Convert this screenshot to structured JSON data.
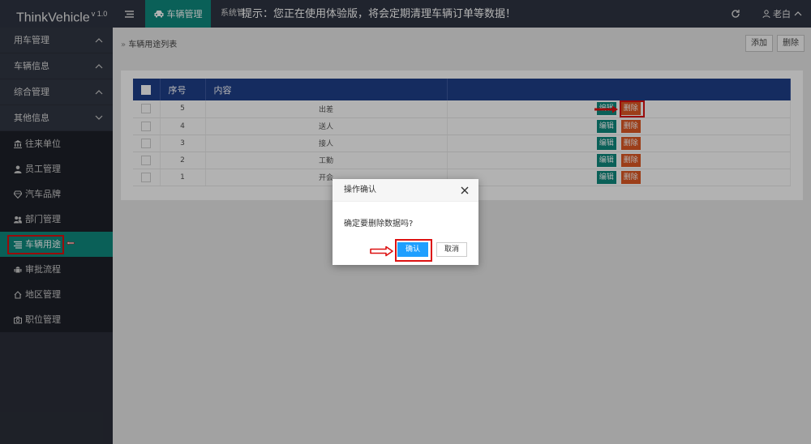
{
  "app": {
    "brand": "ThinkVehicle",
    "version": "v 1.0"
  },
  "topbar": {
    "active_tab": "车辆管理",
    "menu2": "系统管",
    "notice": "提示：您正在使用体验版，将会定期清理车辆订单等数据！",
    "user": "老白"
  },
  "sidebar": {
    "sections": [
      {
        "label": "用车管理"
      },
      {
        "label": "车辆信息"
      },
      {
        "label": "综合管理"
      },
      {
        "label": "其他信息"
      }
    ],
    "items": [
      {
        "label": "往来单位",
        "icon": "bank-icon"
      },
      {
        "label": "员工管理",
        "icon": "user-icon"
      },
      {
        "label": "汽车品牌",
        "icon": "diamond-icon"
      },
      {
        "label": "部门管理",
        "icon": "users-icon"
      },
      {
        "label": "车辆用途",
        "icon": "list-icon"
      },
      {
        "label": "审批流程",
        "icon": "android-icon"
      },
      {
        "label": "地区管理",
        "icon": "home-icon"
      },
      {
        "label": "职位管理",
        "icon": "camera-icon"
      }
    ]
  },
  "main": {
    "breadcrumb": "车辆用途列表",
    "add_label": "添加",
    "delete_label": "删除",
    "table": {
      "headers": [
        "序号",
        "内容"
      ],
      "rows": [
        {
          "no": "5",
          "content": "出差"
        },
        {
          "no": "4",
          "content": "送人"
        },
        {
          "no": "3",
          "content": "接人"
        },
        {
          "no": "2",
          "content": "工勤"
        },
        {
          "no": "1",
          "content": "开会"
        }
      ],
      "edit_label": "编辑",
      "delete_label": "删除"
    }
  },
  "dialog": {
    "title": "操作确认",
    "message": "确定要删除数据吗?",
    "confirm": "确认",
    "cancel": "取消"
  },
  "colors": {
    "accent": "#0f8a7e",
    "header": "#1f3f8a",
    "danger": "#e05a24",
    "primary": "#1e9fff",
    "highlight": "#dd1111"
  }
}
